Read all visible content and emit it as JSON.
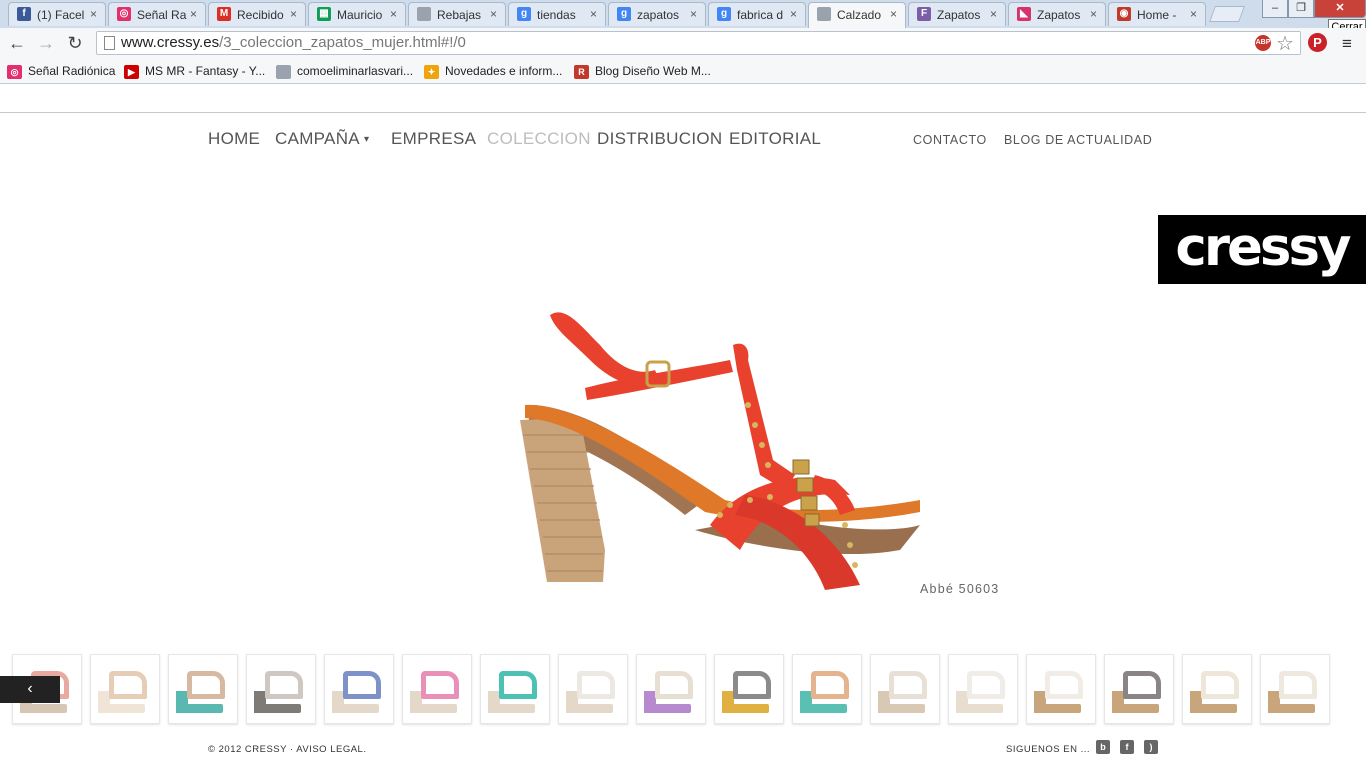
{
  "browser": {
    "tabs": [
      {
        "title": "(1) Facel",
        "icon": "facebook-icon",
        "color": "#3b5998",
        "glyph": "f"
      },
      {
        "title": "Señal Ra",
        "icon": "instagram-icon",
        "color": "#e1306c",
        "glyph": "◎"
      },
      {
        "title": "Recibido",
        "icon": "gmail-icon",
        "color": "#d93025",
        "glyph": "M"
      },
      {
        "title": "Mauricio",
        "icon": "sheets-icon",
        "color": "#0f9d58",
        "glyph": "▦"
      },
      {
        "title": "Rebajas",
        "icon": "page-icon",
        "color": "#9aa3ad",
        "glyph": ""
      },
      {
        "title": "tiendas",
        "icon": "google-icon",
        "color": "#4285f4",
        "glyph": "g"
      },
      {
        "title": "zapatos",
        "icon": "google-icon",
        "color": "#4285f4",
        "glyph": "g"
      },
      {
        "title": "fabrica d",
        "icon": "google-icon",
        "color": "#4285f4",
        "glyph": "g"
      },
      {
        "title": "Calzado",
        "icon": "page-icon",
        "color": "#9aa3ad",
        "glyph": "",
        "active": true
      },
      {
        "title": "Zapatos",
        "icon": "f-icon",
        "color": "#7b5ea7",
        "glyph": "F"
      },
      {
        "title": "Zapatos",
        "icon": "shoe-icon",
        "color": "#d6336c",
        "glyph": "◣"
      },
      {
        "title": "Home -",
        "icon": "eye-icon",
        "color": "#c0392b",
        "glyph": "◉"
      }
    ],
    "tooltip": "Cerrar",
    "url_host": "www.cressy.es",
    "url_path": "/3_coleccion_zapatos_mujer.html#!/0",
    "abp_label": "ABP",
    "bookmarks": [
      {
        "label": "Señal Radiónica",
        "icon": "instagram-icon",
        "color": "#e1306c",
        "glyph": "◎"
      },
      {
        "label": "MS MR - Fantasy - Y...",
        "icon": "youtube-icon",
        "color": "#cc0000",
        "glyph": "▶"
      },
      {
        "label": "comoeliminarlasvari...",
        "icon": "page-icon",
        "color": "#9aa3ad",
        "glyph": ""
      },
      {
        "label": "Novedades e inform...",
        "icon": "spark-icon",
        "color": "#f0a30a",
        "glyph": "✦"
      },
      {
        "label": "Blog Diseño Web M...",
        "icon": "r-logo-icon",
        "color": "#c0392b",
        "glyph": "R"
      }
    ]
  },
  "site": {
    "nav": [
      "HOME",
      "CAMPAÑA",
      "EMPRESA",
      "COLECCION",
      "DISTRIBUCION",
      "EDITORIAL"
    ],
    "campaign_caret": "▾",
    "nav_right": [
      "CONTACTO",
      "BLOG DE ACTUALIDAD"
    ],
    "logo": "cressy",
    "product_caption": "Abbé 50603",
    "prev_arrow": "‹",
    "copyright": "© 2012 CRESSY · AVISO LEGAL.",
    "follow": "SIGUENOS EN ...",
    "social": [
      {
        "icon": "blogger-icon",
        "glyph": "b"
      },
      {
        "icon": "facebook-icon",
        "glyph": "f"
      },
      {
        "icon": "rss-icon",
        "glyph": ")"
      }
    ],
    "accent_red": "#e8412e"
  },
  "thumbnails": [
    {
      "upper": "#e8a9a0",
      "sole": "#d8c6b4"
    },
    {
      "upper": "#e5cdb6",
      "sole": "#efe4d6"
    },
    {
      "upper": "#d7b8a0",
      "sole": "#59b9b0"
    },
    {
      "upper": "#cfc8c2",
      "sole": "#7e7a76"
    },
    {
      "upper": "#7d92c7",
      "sole": "#e4d8c8"
    },
    {
      "upper": "#e890b8",
      "sole": "#e4d8c8"
    },
    {
      "upper": "#4dc1b4",
      "sole": "#e4d8c8"
    },
    {
      "upper": "#ece8e2",
      "sole": "#e4d8c8"
    },
    {
      "upper": "#e8dfd3",
      "sole": "#b78ad0"
    },
    {
      "upper": "#8c8a8a",
      "sole": "#e0b040"
    },
    {
      "upper": "#e5b48e",
      "sole": "#59c0b3"
    },
    {
      "upper": "#e8e0d7",
      "sole": "#d8c8b4"
    },
    {
      "upper": "#f0ede8",
      "sole": "#e8ded0"
    },
    {
      "upper": "#f1ece6",
      "sole": "#c9a57c"
    },
    {
      "upper": "#8a8484",
      "sole": "#c9a57c"
    },
    {
      "upper": "#efe6da",
      "sole": "#c9a57c"
    },
    {
      "upper": "#efe8de",
      "sole": "#c9a57c"
    }
  ]
}
